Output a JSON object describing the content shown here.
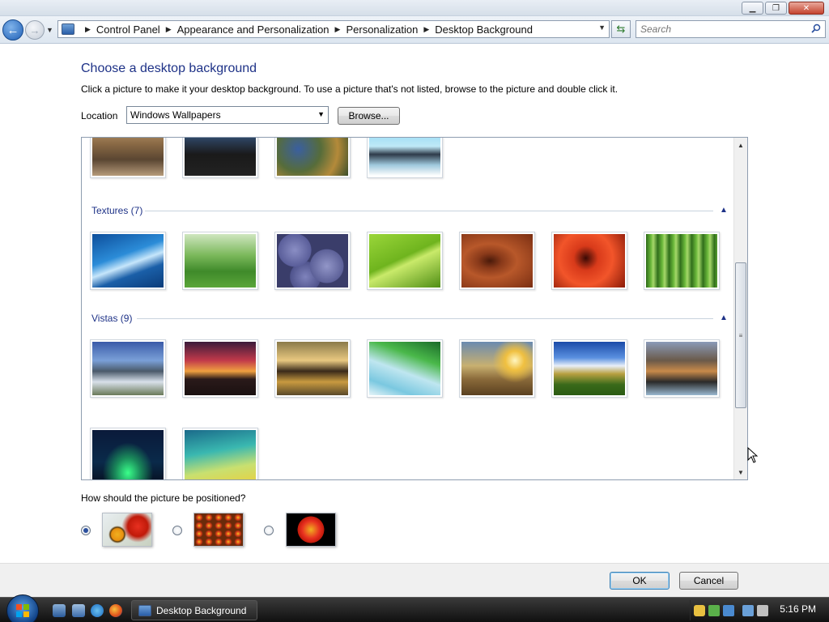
{
  "window": {
    "buttons": {
      "minimize": "▁",
      "maximize": "❐",
      "close": "✕"
    }
  },
  "nav": {
    "breadcrumbs": [
      "Control Panel",
      "Appearance and Personalization",
      "Personalization",
      "Desktop Background"
    ],
    "search_placeholder": "Search"
  },
  "page": {
    "heading": "Choose a desktop background",
    "instructions": "Click a picture to make it your desktop background. To use a picture that's not listed, browse to the picture and double click it.",
    "location_label": "Location",
    "location_value": "Windows Wallpapers",
    "browse_label": "Browse...",
    "groups": [
      {
        "name": "Textures (7)",
        "count": 7
      },
      {
        "name": "Vistas (9)",
        "count": 9
      }
    ],
    "position_question": "How should the picture be positioned?",
    "position_options": [
      "fit-to-screen",
      "tile",
      "center"
    ],
    "position_selected": 0
  },
  "footer": {
    "ok_label": "OK",
    "cancel_label": "Cancel"
  },
  "taskbar": {
    "active_window": "Desktop Background",
    "clock": "5:16 PM"
  },
  "colors": {
    "heading": "#1e3287",
    "accent": "#1e3287"
  }
}
